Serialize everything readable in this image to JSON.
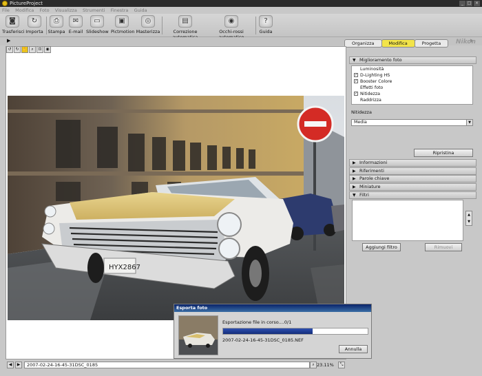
{
  "window": {
    "title": "PictureProject"
  },
  "menu": [
    "File",
    "Modifica",
    "Foto",
    "Visualizza",
    "Strumenti",
    "Finestra",
    "Guida"
  ],
  "toolbar": [
    {
      "label": "Trasferisci",
      "icon": "camera-icon"
    },
    {
      "label": "Importa",
      "icon": "import-icon"
    },
    {
      "label": "Stampa",
      "icon": "printer-icon"
    },
    {
      "label": "E-mail",
      "icon": "email-icon"
    },
    {
      "label": "Slideshow",
      "icon": "slideshow-icon"
    },
    {
      "label": "Pictmotion",
      "icon": "pictmotion-icon"
    },
    {
      "label": "Masterizza",
      "icon": "burn-disc-icon"
    },
    {
      "label": "Correzione automatica",
      "icon": "auto-correct-icon"
    },
    {
      "label": "Occhi-rossi automatico",
      "icon": "red-eye-icon"
    },
    {
      "label": "Guida",
      "icon": "help-icon"
    }
  ],
  "mode_tabs": [
    {
      "label": "Organizza",
      "active": false
    },
    {
      "label": "Modifica",
      "active": true
    },
    {
      "label": "Progetta",
      "active": false
    }
  ],
  "brand": "Nikon",
  "panel": {
    "enhance": {
      "title": "Miglioramento foto",
      "items": [
        {
          "label": "Luminosità",
          "checked": false
        },
        {
          "label": "D-Lighting HS",
          "checked": true
        },
        {
          "label": "Booster Colore",
          "checked": true
        },
        {
          "label": "Effetti foto",
          "checked": false
        },
        {
          "label": "Nitidezza",
          "checked": true
        },
        {
          "label": "Raddrizza",
          "checked": false
        }
      ],
      "sharpness_label": "Nitidezza",
      "sharpness_value": "Media",
      "reset_button": "Ripristina"
    },
    "sections": [
      "Informazioni",
      "Riferimenti",
      "Parole chiave",
      "Miniature"
    ],
    "filters": {
      "title": "Filtri",
      "add_button": "Aggiungi filtro",
      "remove_button": "Rimuovi"
    }
  },
  "status": {
    "filename": "2007-02-24-16-45-31DSC_0185",
    "zoom": "23.11%"
  },
  "dialog": {
    "title": "Esporta foto",
    "message": "Esportazione file in corso....0/1",
    "filename": "2007-02-24-16-45-31DSC_0185.NEF",
    "cancel_button": "Annulla",
    "progress": 0.62
  },
  "colors": {
    "active_tab": "#f2e44a",
    "progress": "#1e3a8a",
    "dialog_title": "#0a246a"
  }
}
